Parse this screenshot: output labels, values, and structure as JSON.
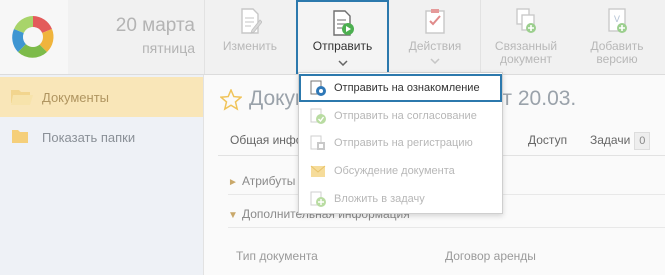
{
  "header": {
    "date_day": "20 марта",
    "date_weekday": "пятница"
  },
  "toolbar": {
    "edit_label": "Изменить",
    "send_label": "Отправить",
    "actions_label": "Действия",
    "linked_label_1": "Связанный",
    "linked_label_2": "документ",
    "add_version_1": "Добавить",
    "add_version_2": "версию"
  },
  "sidebar": {
    "documents": "Документы",
    "show_folders": "Показать папки"
  },
  "main": {
    "title": "Документ аренды №752 от 20.03.",
    "tabs": {
      "general": "Общая информация",
      "access": "Доступ",
      "tasks": "Задачи",
      "tasks_count": "0"
    },
    "accordion": {
      "attributes": "Атрибуты",
      "additional": "Дополнительная информация"
    },
    "doc_type_label": "Тип документа",
    "doc_type_value": "Договор аренды"
  },
  "send_menu": {
    "items": [
      {
        "label": "Отправить на ознакомление"
      },
      {
        "label": "Отправить на согласование"
      },
      {
        "label": "Отправить на регистрацию"
      },
      {
        "label": "Обсуждение документа"
      },
      {
        "label": "Вложить в задачу"
      }
    ]
  }
}
